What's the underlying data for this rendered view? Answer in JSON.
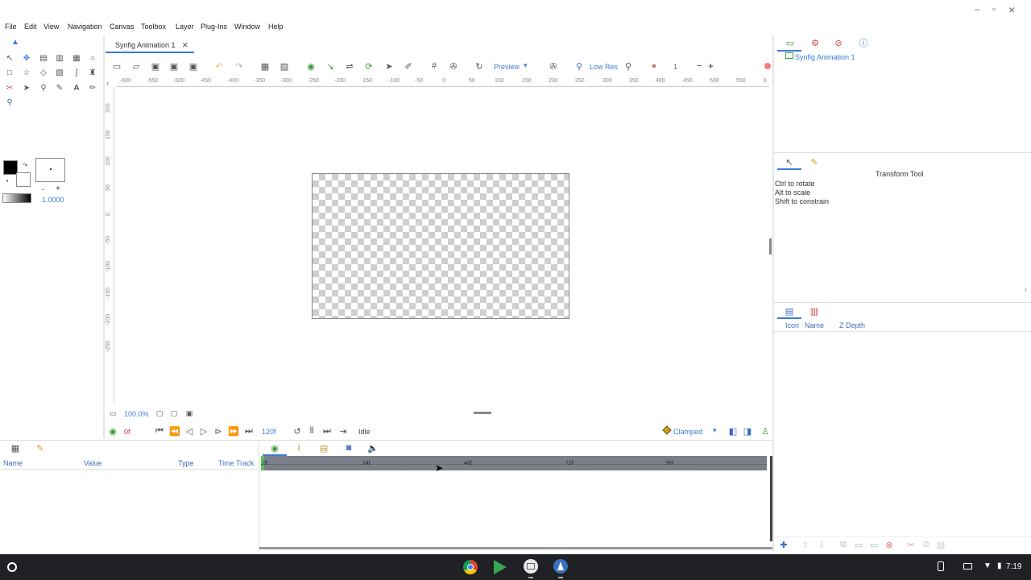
{
  "window": {
    "controls": {
      "minimize": "–",
      "maximize": "▫",
      "close": "×"
    }
  },
  "menubar": {
    "items": [
      "File",
      "Edit",
      "View",
      "Navigation",
      "Canvas",
      "Toolbox",
      "Layer",
      "Plug-Ins",
      "Window",
      "Help"
    ]
  },
  "document_tab": {
    "title": "Synfig Animation 1",
    "close": "×"
  },
  "canvas_toolbar": {
    "preview_label": "Preview",
    "lowres_label": "Low Res",
    "quality_value": "1",
    "minus": "−",
    "plus": "+"
  },
  "hruler": {
    "ticks": [
      "-600",
      "-550",
      "-500",
      "-450",
      "-400",
      "-350",
      "-300",
      "-250",
      "-200",
      "-150",
      "-100",
      "-50",
      "0",
      "50",
      "100",
      "150",
      "200",
      "250",
      "300",
      "350",
      "400",
      "450",
      "500",
      "550",
      "6"
    ]
  },
  "vruler": {
    "ticks": [
      "200",
      "150",
      "100",
      "50",
      "0",
      "-50",
      "-100",
      "-150",
      "-200",
      "-250"
    ]
  },
  "toolbox": {
    "outline_color": "#000000",
    "fill_color": "#ffffff",
    "brush_size_minus": "-",
    "brush_size_plus": "+",
    "opacity_value": "1.0000"
  },
  "canvas_bottom": {
    "zoom": "100.0%"
  },
  "timebar": {
    "current_frame": "0f",
    "end_frame": "120f",
    "status": "Idle",
    "interpolation": "Clamped"
  },
  "params_panel": {
    "columns": [
      "Name",
      "Value",
      "Type",
      "Time Track"
    ]
  },
  "timetrack": {
    "marks": [
      "0f",
      "24f",
      "48f",
      "72f",
      "96f"
    ]
  },
  "canvas_browser": {
    "item": "Synfig Animation 1"
  },
  "tool_options": {
    "title": "Transform Tool",
    "hints": [
      "Ctrl to rotate",
      "Alt to scale",
      "Shift to constrain"
    ]
  },
  "layers_panel": {
    "columns": [
      "Icon",
      "Name",
      "Z Depth"
    ]
  },
  "shelf": {
    "time": "7:19",
    "apps": [
      "chrome-icon",
      "play-store-icon",
      "files-icon",
      "synfig-icon"
    ]
  },
  "colors": {
    "accent": "#3a7bd5",
    "shelf_bg": "#202124",
    "timebar_bg": "#7a7f8a",
    "record_red": "#e04040"
  }
}
